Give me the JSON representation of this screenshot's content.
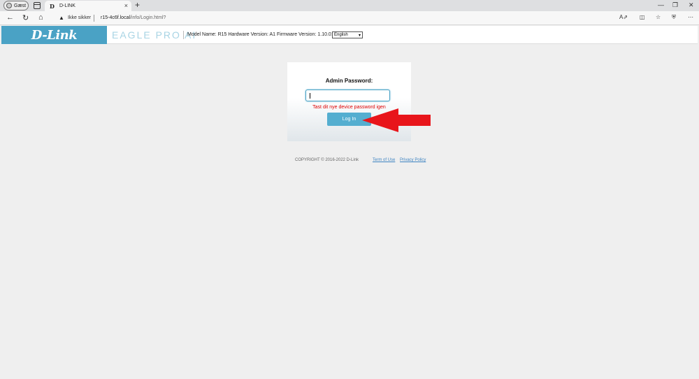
{
  "browser": {
    "guest_label": "Gæst",
    "tab_favicon": "D",
    "tab_title": "D-LINK",
    "tab_close": "×",
    "new_tab": "+",
    "security_text": "Ikke sikker",
    "url_host": "r15-4c6f.local",
    "url_path": "/info/Login.html?",
    "icons": [
      "back-icon",
      "reload-icon",
      "home-icon",
      "warning-icon",
      "read-aloud-icon",
      "split-screen-icon",
      "favorites-icon",
      "shield-icon"
    ]
  },
  "header": {
    "logo_text": "D-Link",
    "product_text": "EAGLE PRO AI",
    "model_info": "Model Name: R15 Hardware Version: A1 Firmware Version: 1.10.01",
    "language_selected": "English",
    "brand_color": "#4aa2c5"
  },
  "login": {
    "admin_label": "Admin Password:",
    "password_value": "",
    "error_message": "Tast dit nye device password igen",
    "login_button": "Log In",
    "error_color": "#dd0000"
  },
  "footer": {
    "copyright": "COPYRIGHT © 2016-2022 D-Link",
    "terms": "Term of Use",
    "privacy": "Privacy Policy"
  },
  "annotation": {
    "arrow_color": "#e8151b"
  }
}
